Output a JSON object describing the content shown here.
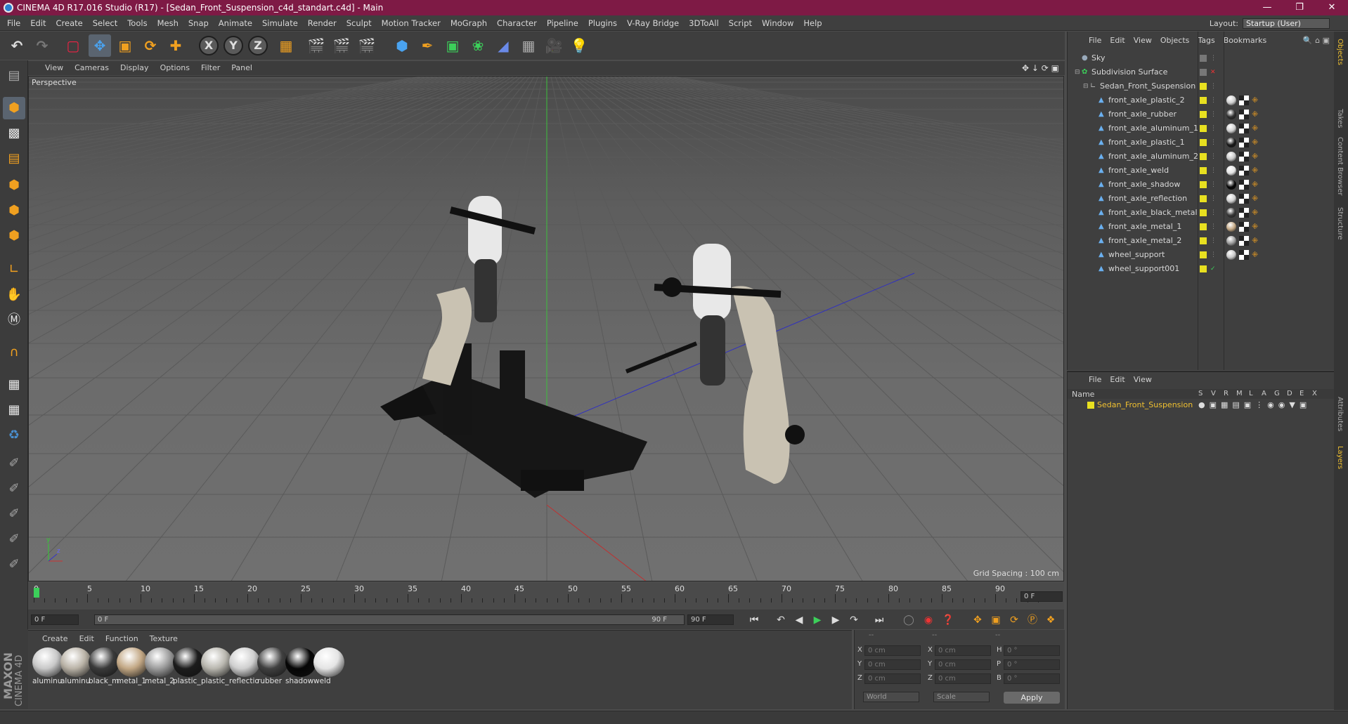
{
  "window": {
    "title": "CINEMA 4D R17.016 Studio (R17) - [Sedan_Front_Suspension_c4d_standart.c4d] - Main"
  },
  "menubar": [
    "File",
    "Edit",
    "Create",
    "Select",
    "Tools",
    "Mesh",
    "Snap",
    "Animate",
    "Simulate",
    "Render",
    "Sculpt",
    "Motion Tracker",
    "MoGraph",
    "Character",
    "Pipeline",
    "Plugins",
    "V-Ray Bridge",
    "3DToAll",
    "Script",
    "Window",
    "Help"
  ],
  "layout": {
    "label": "Layout:",
    "value": "Startup (User)"
  },
  "viewport": {
    "menu": [
      "View",
      "Cameras",
      "Display",
      "Options",
      "Filter",
      "Panel"
    ],
    "label": "Perspective",
    "grid_spacing": "Grid Spacing : 100 cm"
  },
  "timeline": {
    "ticks": [
      "0",
      "5",
      "10",
      "15",
      "20",
      "25",
      "30",
      "35",
      "40",
      "45",
      "50",
      "55",
      "60",
      "65",
      "70",
      "75",
      "80",
      "85",
      "90"
    ],
    "end_field": "0 F",
    "start_field": "0 F",
    "range_start": "0 F",
    "range_end": "90 F",
    "max_field": "90 F"
  },
  "materials": {
    "menu": [
      "Create",
      "Edit",
      "Function",
      "Texture"
    ],
    "items": [
      {
        "label": "aluminu",
        "color": "#c8c8c8"
      },
      {
        "label": "aluminu",
        "color": "#b9b2a6"
      },
      {
        "label": "black_m",
        "color": "#3a3a3a"
      },
      {
        "label": "metal_1",
        "color": "#c2a784"
      },
      {
        "label": "metal_2",
        "color": "#9c9c9c"
      },
      {
        "label": "plastic_",
        "color": "#1c1c1c"
      },
      {
        "label": "plastic_",
        "color": "#b8b6ae"
      },
      {
        "label": "reflectio",
        "color": "#cfcfcf"
      },
      {
        "label": "rubber",
        "color": "#404040"
      },
      {
        "label": "shadow",
        "color": "#050505"
      },
      {
        "label": "weld",
        "color": "#e4e4e4"
      }
    ]
  },
  "coords": {
    "header": [
      "--",
      "--",
      "--"
    ],
    "rows": [
      {
        "a": "X",
        "av": "0 cm",
        "b": "X",
        "bv": "0 cm",
        "c": "H",
        "cv": "0 °"
      },
      {
        "a": "Y",
        "av": "0 cm",
        "b": "Y",
        "bv": "0 cm",
        "c": "P",
        "cv": "0 °"
      },
      {
        "a": "Z",
        "av": "0 cm",
        "b": "Z",
        "bv": "0 cm",
        "c": "B",
        "cv": "0 °"
      }
    ],
    "mode1": "World",
    "mode2": "Scale",
    "apply": "Apply"
  },
  "objects": {
    "menu": [
      "File",
      "Edit",
      "View",
      "Objects",
      "Tags",
      "Bookmarks"
    ],
    "items": [
      {
        "name": "Sky",
        "indent": 0
      },
      {
        "name": "Subdivision Surface",
        "indent": 0
      },
      {
        "name": "Sedan_Front_Suspension",
        "indent": 1
      },
      {
        "name": "front_axle_plastic_2",
        "indent": 2
      },
      {
        "name": "front_axle_rubber",
        "indent": 2
      },
      {
        "name": "front_axle_aluminum_1",
        "indent": 2
      },
      {
        "name": "front_axle_plastic_1",
        "indent": 2
      },
      {
        "name": "front_axle_aluminum_2",
        "indent": 2
      },
      {
        "name": "front_axle_weld",
        "indent": 2
      },
      {
        "name": "front_axle_shadow",
        "indent": 2
      },
      {
        "name": "front_axle_reflection",
        "indent": 2
      },
      {
        "name": "front_axle_black_metal",
        "indent": 2
      },
      {
        "name": "front_axle_metal_1",
        "indent": 2
      },
      {
        "name": "front_axle_metal_2",
        "indent": 2
      },
      {
        "name": "wheel_support",
        "indent": 2
      },
      {
        "name": "wheel_support001",
        "indent": 2
      }
    ]
  },
  "layers": {
    "menu": [
      "File",
      "Edit",
      "View"
    ],
    "name_header": "Name",
    "col_headers": [
      "S",
      "V",
      "R",
      "M",
      "L",
      "A",
      "G",
      "D",
      "E",
      "X"
    ],
    "item": "Sedan_Front_Suspension"
  },
  "right_tabs": [
    "Objects",
    "Takes",
    "Content Browser",
    "Structure",
    "Attributes",
    "Layers"
  ],
  "maxon": {
    "line1": "MAXON",
    "line2": "CINEMA 4D"
  }
}
